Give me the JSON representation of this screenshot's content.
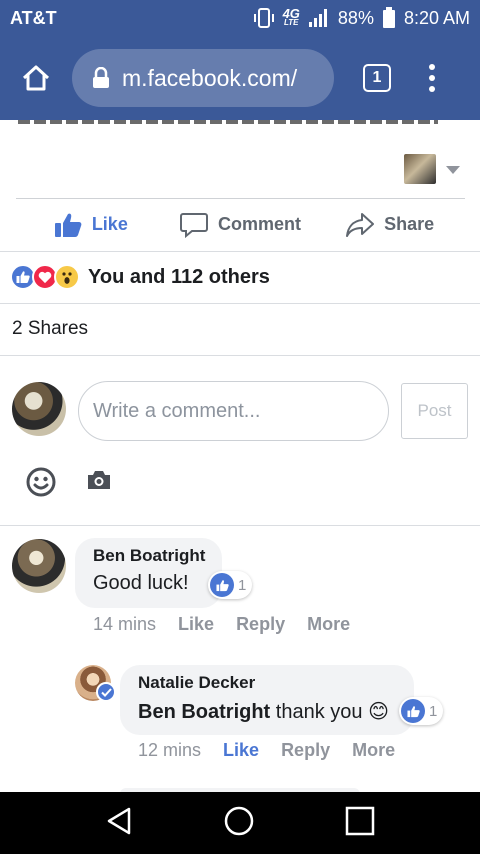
{
  "status_bar": {
    "carrier": "AT&T",
    "network": "4G",
    "network_sub": "LTE",
    "battery": "88%",
    "time": "8:20 AM"
  },
  "browser": {
    "url": "m.facebook.com/",
    "tab_count": "1"
  },
  "actions": {
    "like": "Like",
    "comment": "Comment",
    "share": "Share"
  },
  "reactions": {
    "summary": "You and 112 others",
    "icons": [
      "like-reaction",
      "love-reaction",
      "wow-reaction"
    ]
  },
  "shares": "2 Shares",
  "composer": {
    "placeholder": "Write a comment...",
    "post_label": "Post"
  },
  "comments": [
    {
      "author": "Ben Boatright",
      "text": "Good luck!",
      "likes": "1",
      "time": "14 mins",
      "like_label": "Like",
      "reply_label": "Reply",
      "more_label": "More"
    },
    {
      "author": "Natalie Decker",
      "mention": "Ben Boatright",
      "text": "thank you",
      "emoji": "😊",
      "likes": "1",
      "time": "12 mins",
      "like_label": "Like",
      "reply_label": "Reply",
      "more_label": "More"
    }
  ],
  "colors": {
    "brand": "#3b5998",
    "like_blue": "#4a76d3",
    "meta_gray": "#90949c"
  }
}
